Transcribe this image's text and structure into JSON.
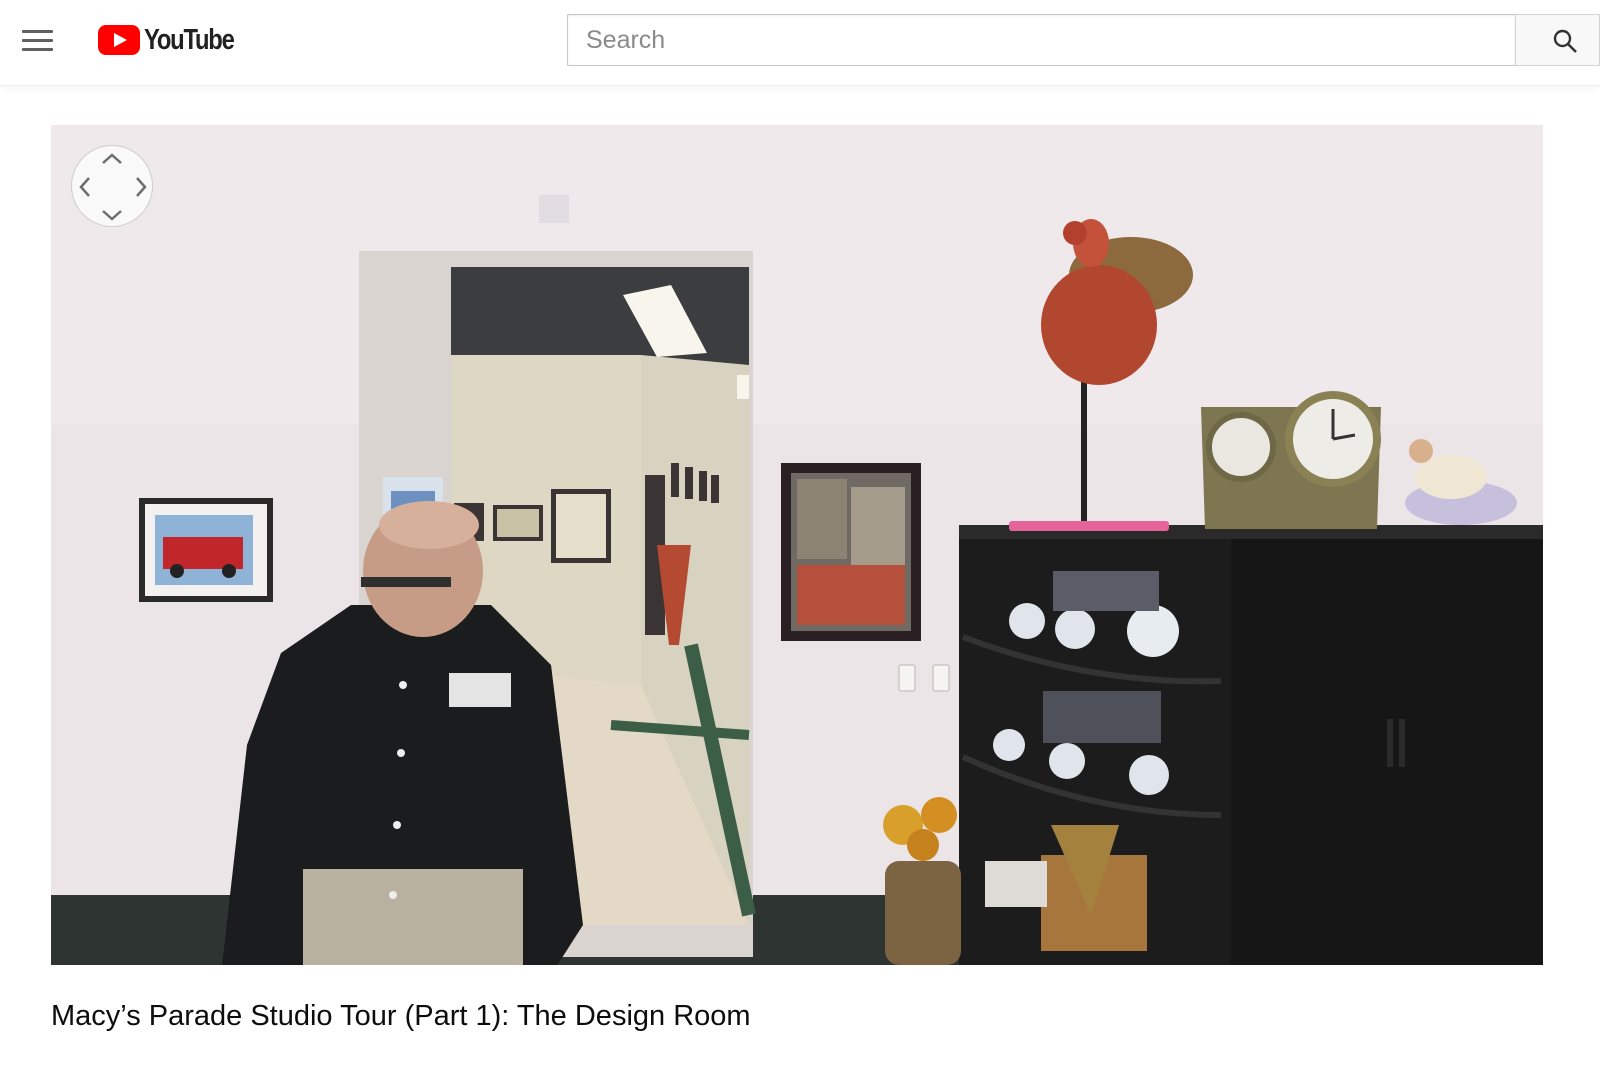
{
  "header": {
    "logo_text": "YouTube",
    "search_placeholder": "Search",
    "search_value": ""
  },
  "player": {
    "mode": "360-degree video",
    "nav_control": "360 pan control"
  },
  "video": {
    "title": "Macy’s Parade Studio Tour (Part 1): The Design Room"
  },
  "colors": {
    "brand_red": "#ff0000",
    "text_primary": "#0d0d0d"
  },
  "icons": [
    "menu-icon",
    "youtube-logo-icon",
    "search-icon",
    "pan-up-icon",
    "pan-down-icon",
    "pan-left-icon",
    "pan-right-icon"
  ]
}
